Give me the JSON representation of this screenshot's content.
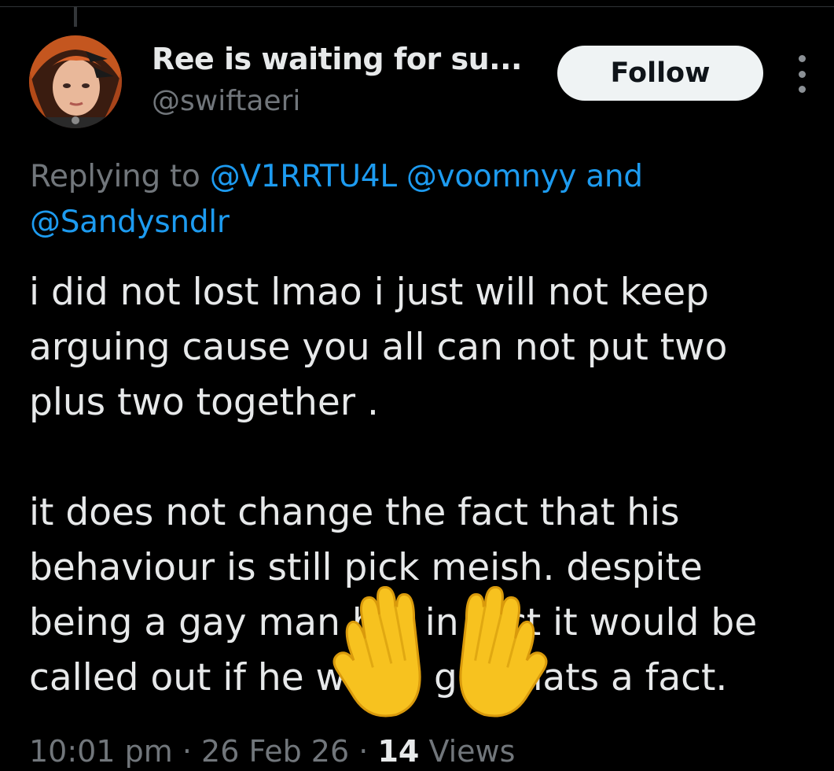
{
  "user": {
    "display_name": "Ree is waiting for su...",
    "handle": "@swiftaeri"
  },
  "follow_label": "Follow",
  "reply": {
    "prefix": "Replying to",
    "mention_1": "@V1RRTU4L",
    "mention_2": "@voomnyy",
    "conjunction": "and",
    "mention_3": "@Sandysndlr"
  },
  "tweet": {
    "paragraph_1": "i did not lost lmao i just will not keep\narguing cause you all can not put two\nplus two together .",
    "paragraph_2": "it does not change the fact that his\nbehaviour is still pick meish. despite\nbeing a gay man but in fact it would be\ncalled out if he was a girl thats a fact."
  },
  "meta": {
    "time": "10:01 pm",
    "sep_1": "·",
    "date": "26 Feb 26",
    "sep_2": "·",
    "views_count": "14",
    "views_label": "Views"
  },
  "icons": {
    "more": "more-vertical-icon",
    "overlay": "raised-hands-emoji-icon"
  },
  "colors": {
    "background": "#000000",
    "text": "#e7e9ea",
    "secondary": "#71767b",
    "link": "#1d9bf0",
    "follow_bg": "#eff3f4"
  }
}
